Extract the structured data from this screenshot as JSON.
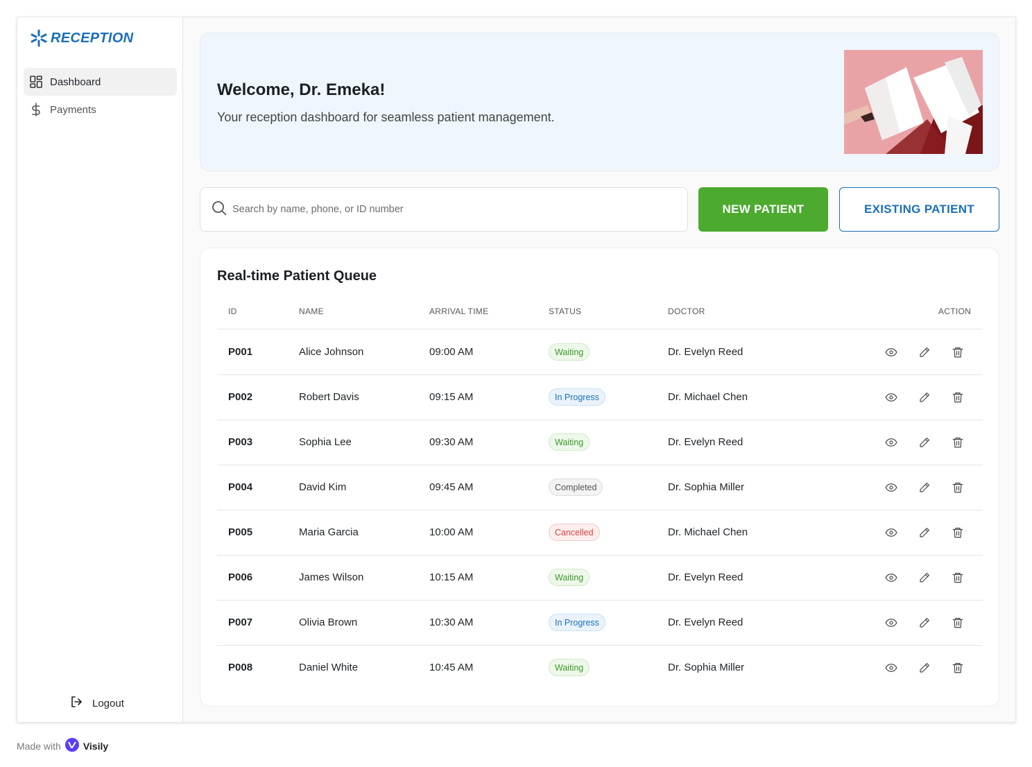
{
  "app": {
    "brand": "RECEPTION"
  },
  "sidebar": {
    "items": [
      {
        "label": "Dashboard",
        "icon": "dashboard-grid-icon",
        "active": true
      },
      {
        "label": "Payments",
        "icon": "dollar-icon",
        "active": false
      }
    ],
    "logout_label": "Logout"
  },
  "welcome": {
    "title": "Welcome, Dr. Emeka!",
    "subtitle": "Your reception dashboard for seamless patient management."
  },
  "search": {
    "placeholder": "Search by name, phone, or ID number",
    "value": ""
  },
  "actions": {
    "new_patient": "NEW PATIENT",
    "existing_patient": "EXISTING PATIENT"
  },
  "queue": {
    "title": "Real-time Patient Queue",
    "columns": {
      "id": "ID",
      "name": "NAME",
      "arrival": "ARRIVAL TIME",
      "status": "STATUS",
      "doctor": "DOCTOR",
      "action": "ACTION"
    },
    "rows": [
      {
        "id": "P001",
        "name": "Alice Johnson",
        "arrival": "09:00 AM",
        "status": "Waiting",
        "doctor": "Dr. Evelyn Reed"
      },
      {
        "id": "P002",
        "name": "Robert Davis",
        "arrival": "09:15 AM",
        "status": "In Progress",
        "doctor": "Dr. Michael Chen"
      },
      {
        "id": "P003",
        "name": "Sophia Lee",
        "arrival": "09:30 AM",
        "status": "Waiting",
        "doctor": "Dr. Evelyn Reed"
      },
      {
        "id": "P004",
        "name": "David Kim",
        "arrival": "09:45 AM",
        "status": "Completed",
        "doctor": "Dr. Sophia Miller"
      },
      {
        "id": "P005",
        "name": "Maria Garcia",
        "arrival": "10:00 AM",
        "status": "Cancelled",
        "doctor": "Dr. Michael Chen"
      },
      {
        "id": "P006",
        "name": "James Wilson",
        "arrival": "10:15 AM",
        "status": "Waiting",
        "doctor": "Dr. Evelyn Reed"
      },
      {
        "id": "P007",
        "name": "Olivia Brown",
        "arrival": "10:30 AM",
        "status": "In Progress",
        "doctor": "Dr. Evelyn Reed"
      },
      {
        "id": "P008",
        "name": "Daniel White",
        "arrival": "10:45 AM",
        "status": "Waiting",
        "doctor": "Dr. Sophia Miller"
      }
    ]
  },
  "status_colors": {
    "Waiting": {
      "fg": "#3c9a2a",
      "bg": "#eef8ea",
      "border": "#cfe8c6"
    },
    "In Progress": {
      "fg": "#1a6fb8",
      "bg": "#eaf3fc",
      "border": "#c8dff3"
    },
    "Completed": {
      "fg": "#555555",
      "bg": "#f3f3f4",
      "border": "#dcdcdc"
    },
    "Cancelled": {
      "fg": "#d64545",
      "bg": "#fdeeee",
      "border": "#f3c9c9"
    }
  },
  "colors": {
    "brand": "#1a6fb8",
    "primary_green": "#4caa2f"
  },
  "footer": {
    "made_with": "Made with",
    "visily": "Visily"
  }
}
